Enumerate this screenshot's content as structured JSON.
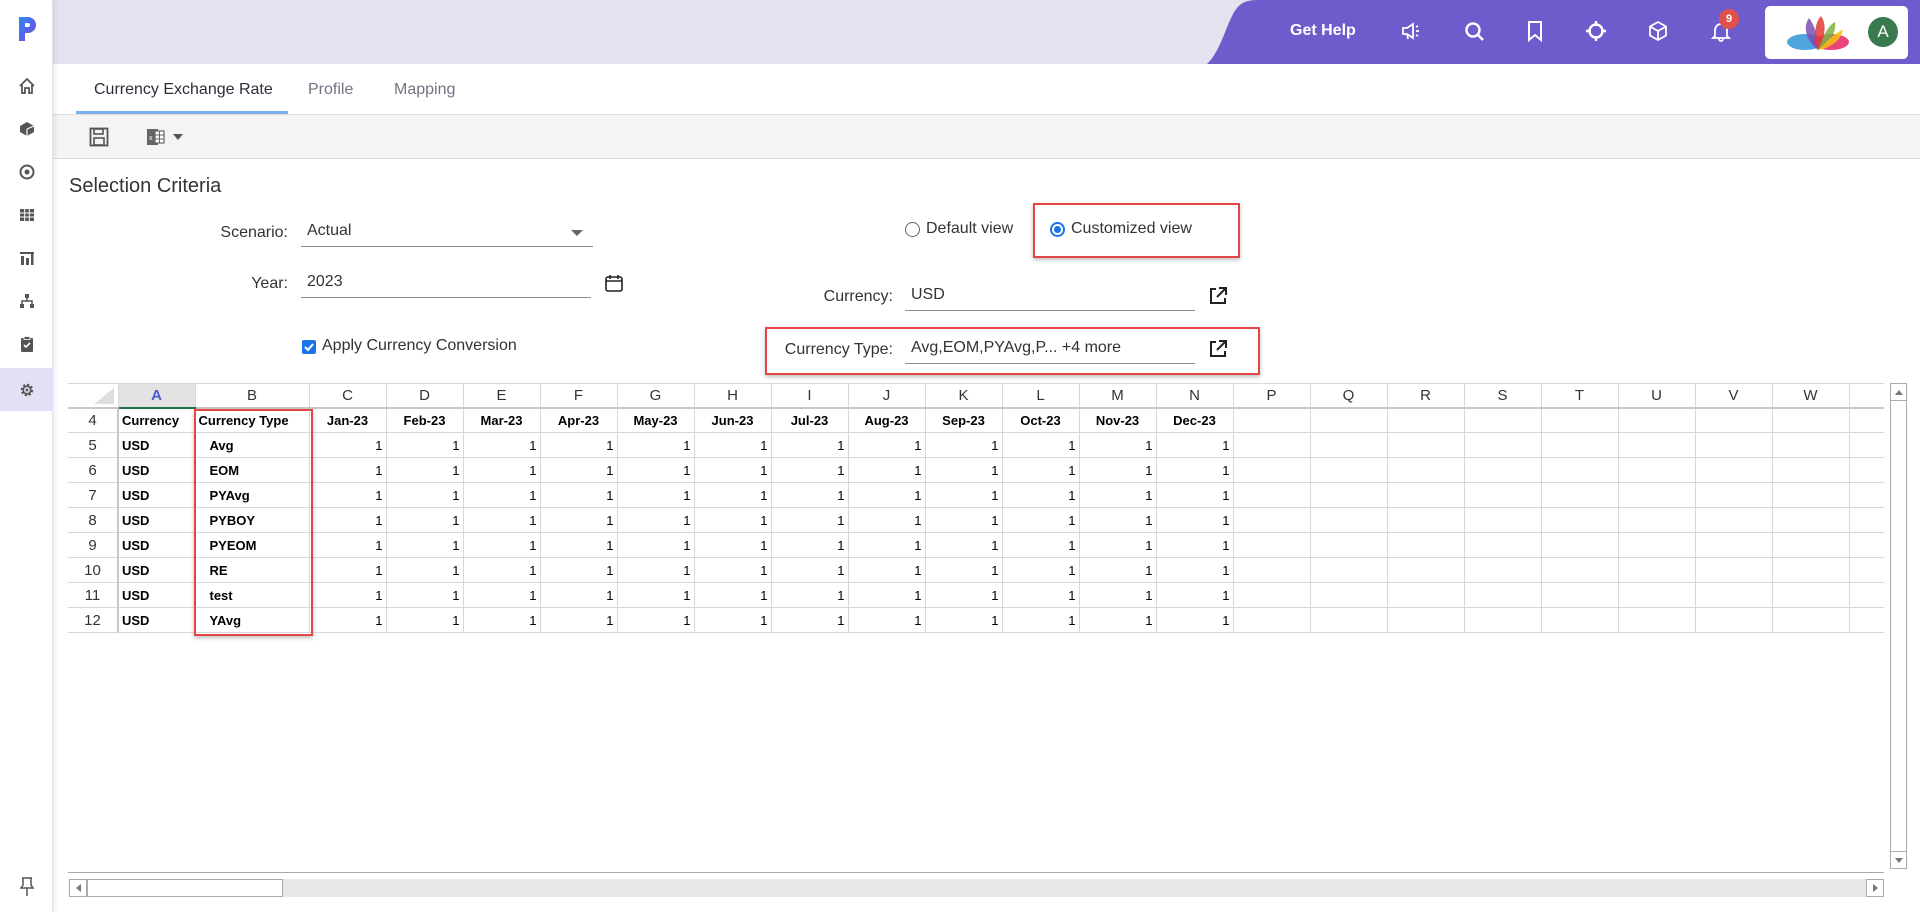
{
  "brand": {
    "logo": "P",
    "accent": "#6d5dcc"
  },
  "sidebar": {
    "items": [
      {
        "name": "home",
        "icon": "home-icon"
      },
      {
        "name": "cube",
        "icon": "cube-icon"
      },
      {
        "name": "target",
        "icon": "target-icon"
      },
      {
        "name": "grid",
        "icon": "grid-icon"
      },
      {
        "name": "reports",
        "icon": "chart-icon"
      },
      {
        "name": "hierarchy",
        "icon": "hierarchy-icon"
      },
      {
        "name": "tasks",
        "icon": "clipboard-check-icon"
      },
      {
        "name": "settings",
        "icon": "gear-icon",
        "active": true
      }
    ],
    "pin_icon": "pin-icon"
  },
  "header": {
    "get_help": "Get Help",
    "icons": [
      "megaphone-icon",
      "search-icon",
      "bookmark-icon",
      "crosshair-icon",
      "cube-icon",
      "bell-icon"
    ],
    "notification_count": "9",
    "avatar_initial": "A"
  },
  "tabs": [
    {
      "label": "Currency Exchange Rate",
      "active": true
    },
    {
      "label": "Profile"
    },
    {
      "label": "Mapping"
    }
  ],
  "toolbar": {
    "save": "save-icon",
    "excel": "excel-icon"
  },
  "selection": {
    "title": "Selection Criteria",
    "scenario_label": "Scenario:",
    "scenario_value": "Actual",
    "year_label": "Year:",
    "year_value": "2023",
    "apply_conversion_label": "Apply Currency Conversion",
    "apply_conversion_checked": true,
    "default_view_label": "Default view",
    "customized_view_label": "Customized view",
    "selected_view": "Customized view",
    "currency_label": "Currency:",
    "currency_value": "USD",
    "currency_type_label": "Currency Type:",
    "currency_type_value": "Avg,EOM,PYAvg,P... +4 more"
  },
  "sheet": {
    "columns": [
      "A",
      "B",
      "C",
      "D",
      "E",
      "F",
      "G",
      "H",
      "I",
      "J",
      "K",
      "L",
      "M",
      "N",
      "P",
      "Q",
      "R",
      "S",
      "T",
      "U",
      "V",
      "W"
    ],
    "selected_column": "A",
    "header_row": {
      "row": "4",
      "cells": [
        "Currency",
        "Currency Type",
        "Jan-23",
        "Feb-23",
        "Mar-23",
        "Apr-23",
        "May-23",
        "Jun-23",
        "Jul-23",
        "Aug-23",
        "Sep-23",
        "Oct-23",
        "Nov-23",
        "Dec-23"
      ]
    },
    "rows": [
      {
        "row": "5",
        "currency": "USD",
        "type": "Avg",
        "values": [
          "1",
          "1",
          "1",
          "1",
          "1",
          "1",
          "1",
          "1",
          "1",
          "1",
          "1",
          "1"
        ]
      },
      {
        "row": "6",
        "currency": "USD",
        "type": "EOM",
        "values": [
          "1",
          "1",
          "1",
          "1",
          "1",
          "1",
          "1",
          "1",
          "1",
          "1",
          "1",
          "1"
        ]
      },
      {
        "row": "7",
        "currency": "USD",
        "type": "PYAvg",
        "values": [
          "1",
          "1",
          "1",
          "1",
          "1",
          "1",
          "1",
          "1",
          "1",
          "1",
          "1",
          "1"
        ]
      },
      {
        "row": "8",
        "currency": "USD",
        "type": "PYBOY",
        "values": [
          "1",
          "1",
          "1",
          "1",
          "1",
          "1",
          "1",
          "1",
          "1",
          "1",
          "1",
          "1"
        ]
      },
      {
        "row": "9",
        "currency": "USD",
        "type": "PYEOM",
        "values": [
          "1",
          "1",
          "1",
          "1",
          "1",
          "1",
          "1",
          "1",
          "1",
          "1",
          "1",
          "1"
        ]
      },
      {
        "row": "10",
        "currency": "USD",
        "type": "RE",
        "values": [
          "1",
          "1",
          "1",
          "1",
          "1",
          "1",
          "1",
          "1",
          "1",
          "1",
          "1",
          "1"
        ]
      },
      {
        "row": "11",
        "currency": "USD",
        "type": "test",
        "values": [
          "1",
          "1",
          "1",
          "1",
          "1",
          "1",
          "1",
          "1",
          "1",
          "1",
          "1",
          "1"
        ]
      },
      {
        "row": "12",
        "currency": "USD",
        "type": "YAvg",
        "values": [
          "1",
          "1",
          "1",
          "1",
          "1",
          "1",
          "1",
          "1",
          "1",
          "1",
          "1",
          "1"
        ]
      }
    ]
  }
}
